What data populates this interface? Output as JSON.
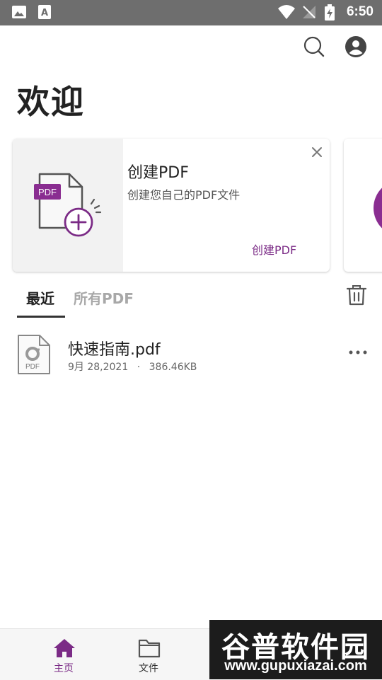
{
  "status_bar": {
    "time": "6:50"
  },
  "header": {
    "title": "欢迎"
  },
  "promo_card": {
    "badge": "PDF",
    "title": "创建PDF",
    "description": "创建您自己的PDF文件",
    "action_label": "创建PDF"
  },
  "tabs": [
    {
      "label": "最近",
      "active": true
    },
    {
      "label": "所有PDF",
      "active": false
    }
  ],
  "files": [
    {
      "name": "快速指南.pdf",
      "date": "9月 28,2021",
      "separator": "·",
      "size": "386.46KB",
      "icon_label": "PDF"
    }
  ],
  "bottom_nav": [
    {
      "label": "主页",
      "icon": "home-icon",
      "active": true
    },
    {
      "label": "文件",
      "icon": "folder-icon",
      "active": false
    }
  ],
  "watermark": {
    "title": "谷普软件园",
    "url": "www.gupuxiazai.com"
  },
  "colors": {
    "accent": "#7b2b86",
    "status_bar": "#6e6e6e",
    "bottom_nav": "#f6f6f6"
  }
}
